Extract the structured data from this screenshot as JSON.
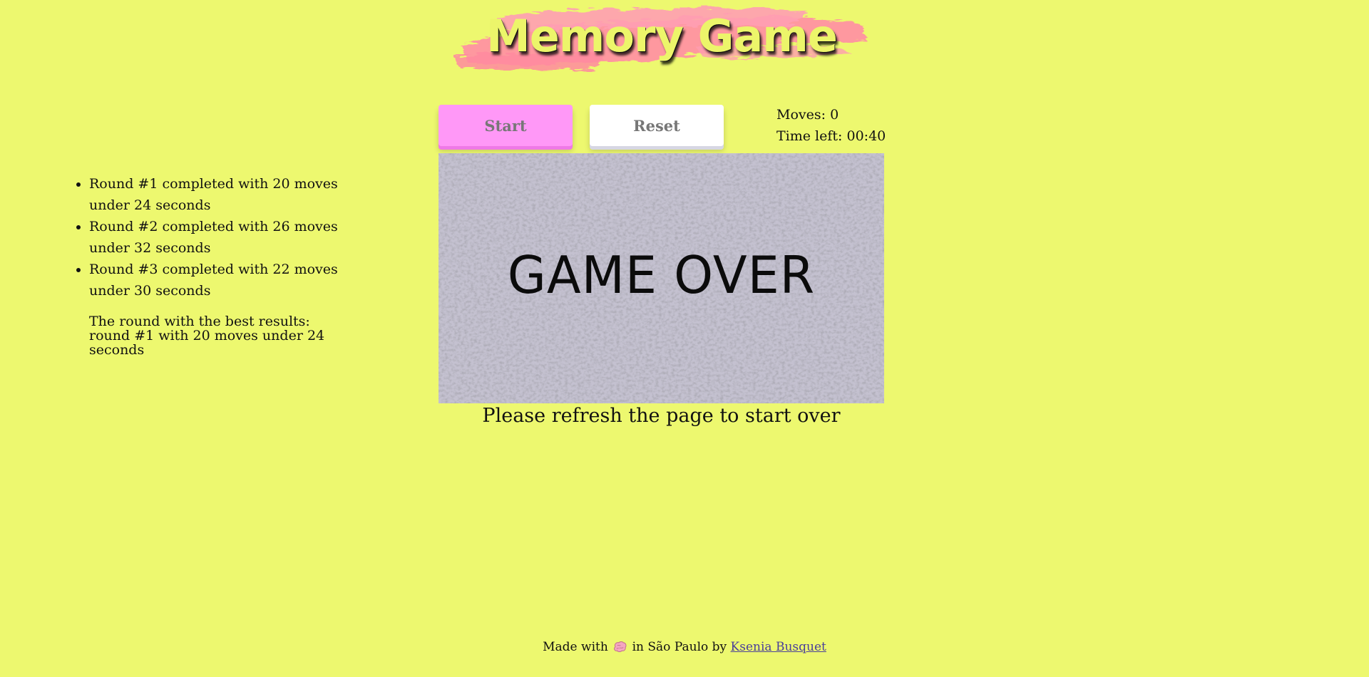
{
  "header": {
    "title": "Memory Game"
  },
  "controls": {
    "start_label": "Start",
    "reset_label": "Reset"
  },
  "stats": {
    "moves_label": "Moves:",
    "moves_value": "0",
    "time_label": "Time left:",
    "time_value": "00:40"
  },
  "game": {
    "over_text": "GAME OVER",
    "refresh_text": "Please refresh the page to start over"
  },
  "rounds": {
    "items": [
      {
        "text": "Round #1 completed with 20 moves under 24 seconds"
      },
      {
        "text": "Round #2 completed with 26 moves under 32 seconds"
      },
      {
        "text": "Round #3 completed with 22 moves under 30 seconds"
      }
    ],
    "best_text": "The round with the best results: round #1 with 20 moves under 24 seconds"
  },
  "footer": {
    "made_with": "Made with",
    "icon": "brain-icon",
    "location": "in São Paulo by",
    "author": "Ksenia Busquet"
  },
  "colors": {
    "background": "#edf86f",
    "start_button": "#ff98f7",
    "reset_button": "#ffffff",
    "brush": "#ff8fa3",
    "link": "#4a3f9a"
  }
}
